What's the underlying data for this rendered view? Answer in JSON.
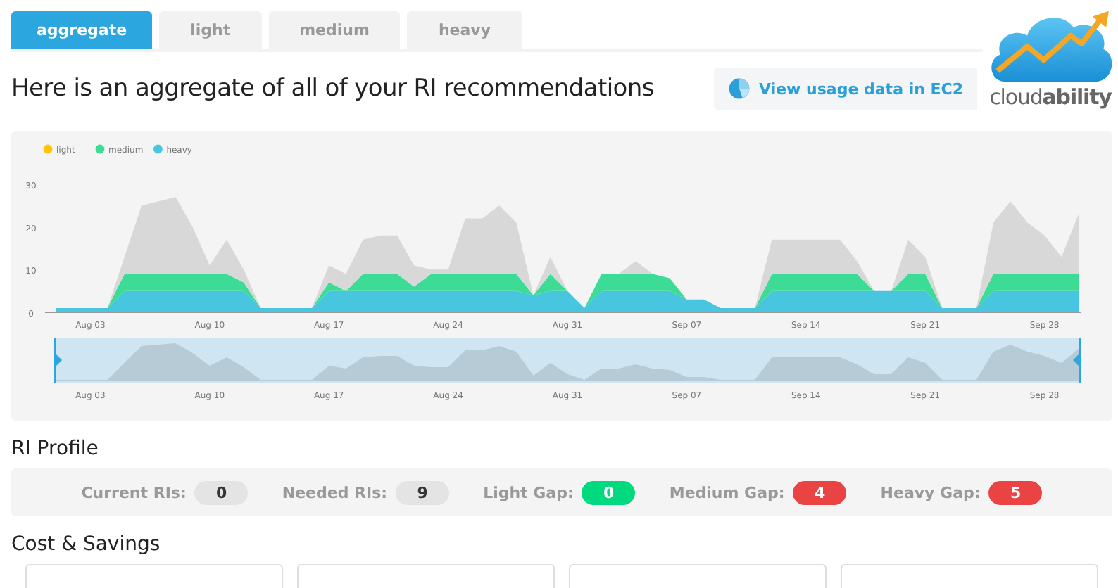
{
  "tabs": [
    {
      "label": "aggregate",
      "selected": true
    },
    {
      "label": "light",
      "selected": false
    },
    {
      "label": "medium",
      "selected": false
    },
    {
      "label": "heavy",
      "selected": false
    }
  ],
  "heading": "Here is an aggregate of all of your RI recommendations",
  "usage_button": {
    "label": "View usage data in EC2"
  },
  "logo": {
    "text": "cloud**ability**"
  },
  "chart": {
    "chart_data": {
      "type": "area",
      "stacked": true,
      "legend": true,
      "categories": [
        null,
        null,
        "Aug 03",
        null,
        null,
        null,
        null,
        null,
        null,
        "Aug 10",
        null,
        null,
        null,
        null,
        null,
        null,
        "Aug 17",
        null,
        null,
        null,
        null,
        null,
        null,
        "Aug 24",
        null,
        null,
        null,
        null,
        null,
        null,
        "Aug 31",
        null,
        null,
        null,
        null,
        null,
        null,
        "Sep 07",
        null,
        null,
        null,
        null,
        null,
        null,
        "Sep 14",
        null,
        null,
        null,
        null,
        null,
        null,
        "Sep 21",
        null,
        null,
        null,
        null,
        null,
        null,
        "Sep 28",
        null,
        null
      ],
      "series": [
        {
          "name": "heavy",
          "color": "#48c6e0",
          "values": [
            1,
            1,
            1,
            1,
            5,
            5,
            5,
            5,
            5,
            5,
            5,
            5,
            1,
            1,
            1,
            1,
            5,
            5,
            5,
            5,
            5,
            5,
            5,
            5,
            5,
            5,
            5,
            5,
            4,
            5,
            5,
            1,
            5,
            5,
            5,
            5,
            5,
            3,
            3,
            1,
            1,
            1,
            5,
            5,
            5,
            5,
            5,
            5,
            5,
            5,
            5,
            5,
            1,
            1,
            1,
            5,
            5,
            5,
            5,
            5,
            5
          ]
        },
        {
          "name": "medium",
          "color": "#3ddc96",
          "values": [
            0,
            0,
            0,
            0,
            4,
            4,
            4,
            4,
            4,
            4,
            4,
            2,
            0,
            0,
            0,
            0,
            2,
            0,
            4,
            4,
            4,
            1,
            4,
            4,
            4,
            4,
            4,
            4,
            0,
            4,
            0,
            0,
            4,
            4,
            4,
            4,
            3,
            0,
            0,
            0,
            0,
            0,
            4,
            4,
            4,
            4,
            4,
            4,
            0,
            0,
            4,
            4,
            0,
            0,
            0,
            4,
            4,
            4,
            4,
            4,
            4
          ]
        },
        {
          "name": "light",
          "color": "#ffc20e",
          "values": [
            null,
            null,
            null,
            null,
            null,
            null,
            null,
            null,
            null,
            null,
            null,
            null,
            null,
            null,
            null,
            null,
            null,
            null,
            null,
            null,
            null,
            null,
            null,
            null,
            null,
            null,
            null,
            null,
            null,
            null,
            null,
            null,
            null,
            null,
            null,
            null,
            null,
            null,
            null,
            null,
            null,
            null,
            null,
            null,
            null,
            null,
            null,
            null,
            null,
            null,
            null,
            null,
            null,
            null,
            null,
            null,
            null,
            null,
            null,
            null,
            null
          ]
        },
        {
          "color": "#d8d8d8",
          "values": [
            0,
            0,
            0,
            0,
            4,
            16,
            17,
            18,
            11,
            2,
            8,
            3,
            0,
            0,
            0,
            0,
            4,
            4,
            8,
            9,
            9,
            5,
            1,
            1,
            13,
            13,
            16,
            12,
            0,
            4,
            0,
            0,
            0,
            0,
            3,
            0,
            0,
            0,
            0,
            0,
            0,
            0,
            8,
            8,
            8,
            8,
            8,
            3,
            0,
            0,
            8,
            4,
            0,
            0,
            0,
            12,
            17,
            12,
            9,
            4,
            14
          ]
        }
      ],
      "ylim": [
        0,
        30
      ],
      "yticks": [
        0,
        10,
        20,
        30
      ]
    },
    "navigator_labels": [
      "Aug 03",
      "Aug 10",
      "Aug 17",
      "Aug 24",
      "Aug 31",
      "Sep 07",
      "Sep 14",
      "Sep 21",
      "Sep 28"
    ]
  },
  "profile": {
    "title": "RI Profile",
    "stats": [
      {
        "label": "Current RIs:",
        "value": "0",
        "color": "#e4e4e4"
      },
      {
        "label": "Needed RIs:",
        "value": "9",
        "color": "#e4e4e4"
      },
      {
        "label": "Light Gap:",
        "value": "0",
        "color": "#00d97e"
      },
      {
        "label": "Medium Gap:",
        "value": "4",
        "color": "#ea4343"
      },
      {
        "label": "Heavy Gap:",
        "value": "5",
        "color": "#ea4343"
      }
    ]
  },
  "costs": {
    "title": "Cost & Savings",
    "cards": [
      {
        "kind": "card"
      },
      {
        "kind": "card"
      },
      {
        "kind": "card"
      },
      {
        "kind": "card"
      }
    ]
  }
}
